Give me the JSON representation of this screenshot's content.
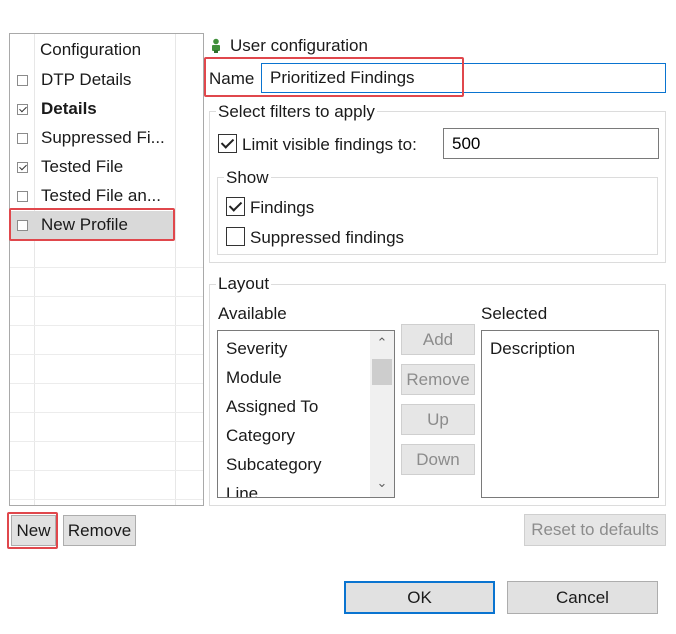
{
  "profiles": {
    "header": "Configuration",
    "items": [
      {
        "label": "DTP Details",
        "checked": false,
        "bold": false
      },
      {
        "label": "Details",
        "checked": true,
        "bold": true
      },
      {
        "label": "Suppressed Fi...",
        "checked": false,
        "bold": false
      },
      {
        "label": "Tested File",
        "checked": true,
        "bold": false
      },
      {
        "label": "Tested File an...",
        "checked": false,
        "bold": false
      },
      {
        "label": "New Profile",
        "checked": false,
        "bold": false,
        "selected": true
      }
    ],
    "new_button": "New",
    "remove_button": "Remove"
  },
  "config": {
    "title": "User configuration",
    "title_icon": "user-config-icon",
    "name_label": "Name",
    "name_value": "Prioritized Findings"
  },
  "filters": {
    "group_title": "Select filters to apply",
    "limit_label": "Limit visible findings to:",
    "limit_checked": true,
    "limit_value": "500",
    "show": {
      "title": "Show",
      "findings_label": "Findings",
      "findings_checked": true,
      "suppressed_label": "Suppressed findings",
      "suppressed_checked": false
    }
  },
  "layout": {
    "group_title": "Layout",
    "available_label": "Available",
    "available_items": [
      "Severity",
      "Module",
      "Assigned To",
      "Category",
      "Subcategory",
      "Line"
    ],
    "selected_label": "Selected",
    "selected_items": [
      "Description"
    ],
    "buttons": {
      "add": "Add",
      "remove": "Remove",
      "up": "Up",
      "down": "Down"
    }
  },
  "footer": {
    "reset_button": "Reset to defaults",
    "ok_button": "OK",
    "cancel_button": "Cancel"
  },
  "colors": {
    "highlight_red": "#e0474c",
    "focus_blue": "#0a74d0"
  }
}
